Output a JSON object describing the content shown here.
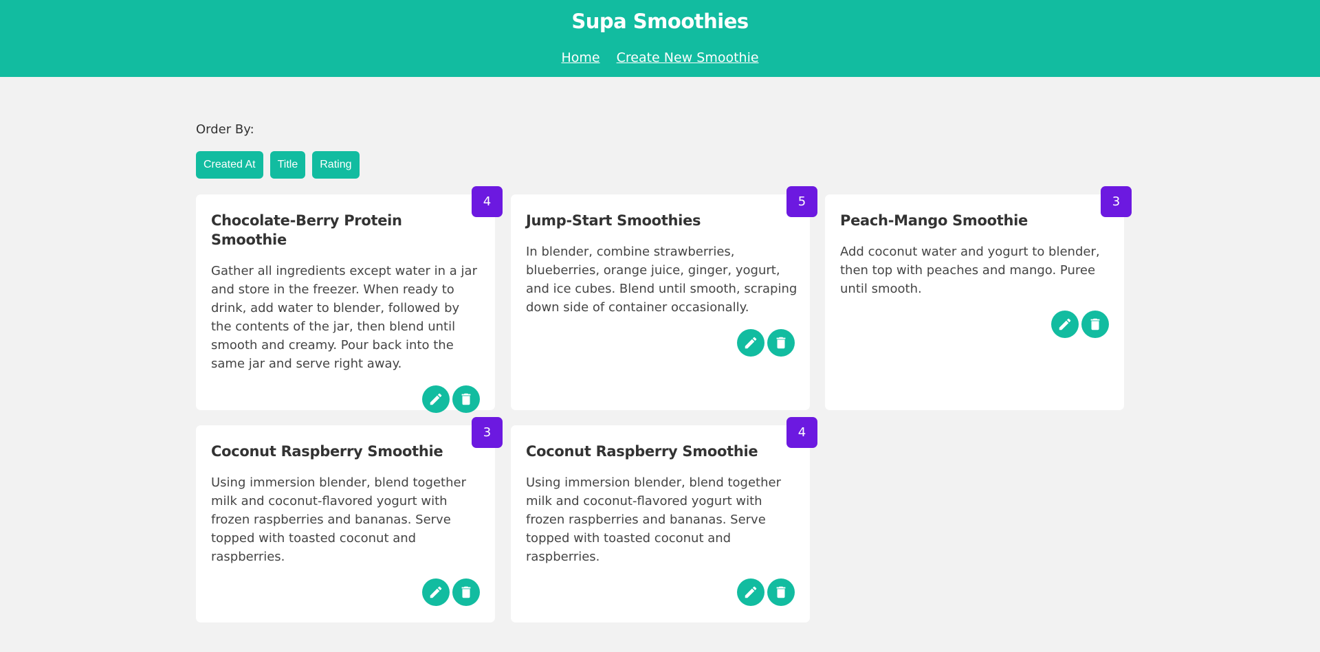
{
  "header": {
    "title": "Supa Smoothies",
    "links": [
      "Home",
      "Create New Smoothie"
    ]
  },
  "order": {
    "label": "Order By:",
    "buttons": [
      "Created At",
      "Title",
      "Rating"
    ]
  },
  "smoothies": [
    {
      "title": "Chocolate-Berry Protein Smoothie",
      "method": "Gather all ingredients except water in a jar and store in the freezer. When ready to drink, add water to blender, followed by the contents of the jar, then blend until smooth and creamy. Pour back into the same jar and serve right away.",
      "rating": "4"
    },
    {
      "title": "Jump-Start Smoothies",
      "method": "In blender, combine strawberries, blueberries, orange juice, ginger, yogurt, and ice cubes. Blend until smooth, scraping down side of container occasionally.",
      "rating": "5"
    },
    {
      "title": "Peach-Mango Smoothie",
      "method": "Add coconut water and yogurt to blender, then top with peaches and mango. Puree until smooth.",
      "rating": "3"
    },
    {
      "title": "Coconut Raspberry Smoothie",
      "method": "Using immersion blender, blend together milk and coconut-flavored yogurt with frozen raspberries and bananas. Serve topped with toasted coconut and raspberries.",
      "rating": "3"
    },
    {
      "title": "Coconut Raspberry Smoothie",
      "method": "Using immersion blender, blend together milk and coconut-flavored yogurt with frozen raspberries and bananas. Serve topped with toasted coconut and raspberries.",
      "rating": "4"
    }
  ],
  "icons": {
    "edit": "pencil-icon",
    "delete": "trash-icon"
  },
  "colors": {
    "brand": "#12bca0",
    "rating": "#6c19e0",
    "background": "#f2f2f2"
  }
}
